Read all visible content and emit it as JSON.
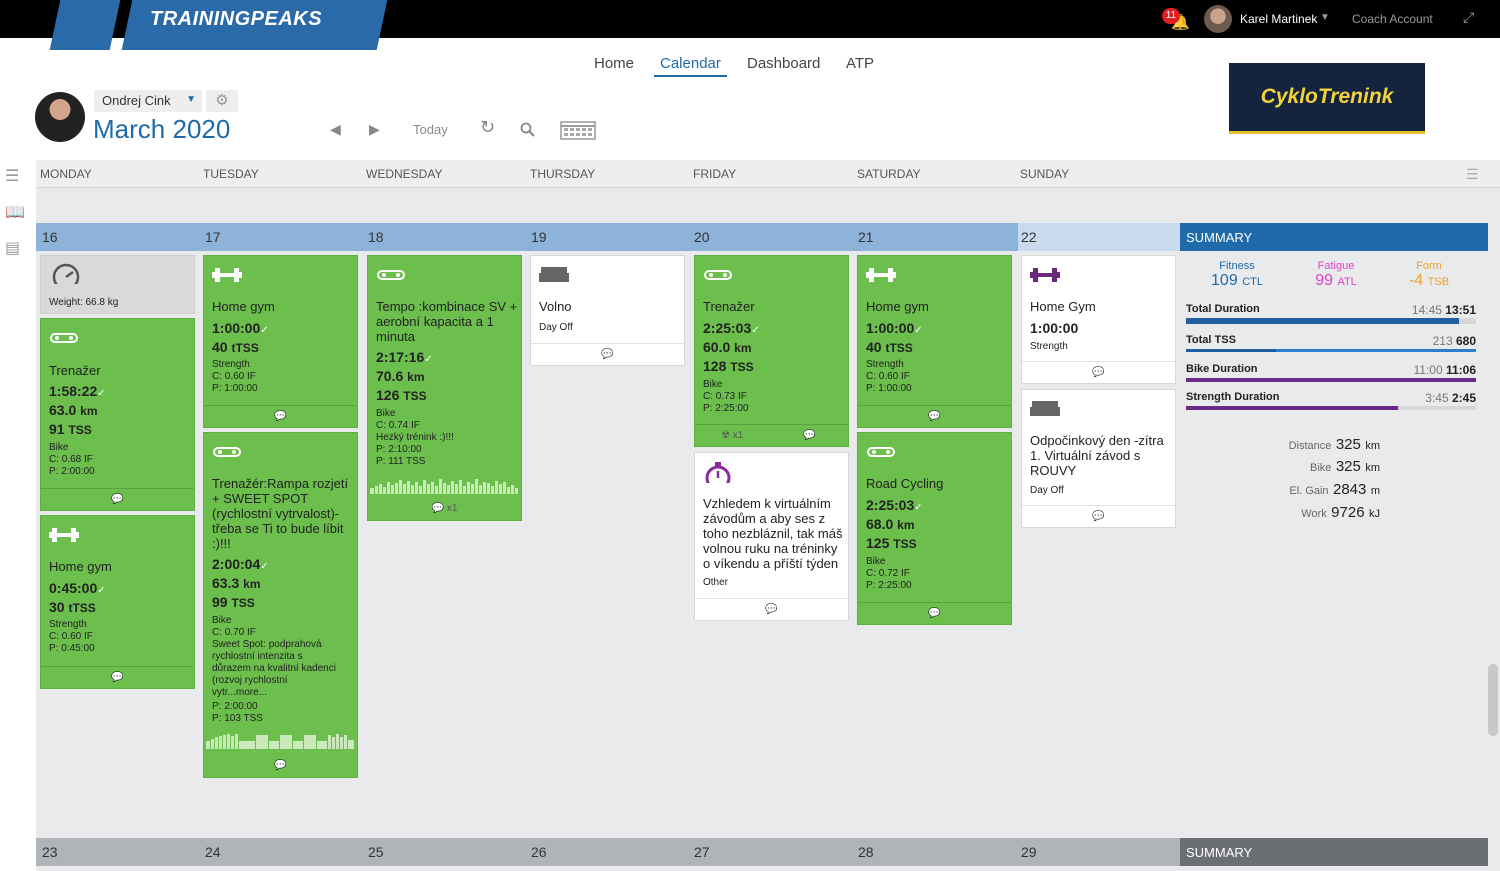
{
  "topbar": {
    "logo": "TRAININGPEAKS",
    "notifications": "11",
    "user_name": "Karel Martinek",
    "coach_account": "Coach Account"
  },
  "nav": {
    "home": "Home",
    "calendar": "Calendar",
    "dashboard": "Dashboard",
    "atp": "ATP"
  },
  "athlete": {
    "name": "Ondrej Cink",
    "month": "March",
    "year": "2020",
    "today": "Today"
  },
  "brand": "CykloTrenink",
  "days": [
    "MONDAY",
    "TUESDAY",
    "WEDNESDAY",
    "THURSDAY",
    "FRIDAY",
    "SATURDAY",
    "SUNDAY"
  ],
  "week1": [
    "16",
    "17",
    "18",
    "19",
    "20",
    "21",
    "22"
  ],
  "week2": [
    "23",
    "24",
    "25",
    "26",
    "27",
    "28",
    "29"
  ],
  "summary_label": "SUMMARY",
  "mon": {
    "weight": "Weight: 66.8 kg",
    "w1": {
      "title": "Trenažer",
      "dur": "1:58:22",
      "dist": "63.0",
      "dist_unit": "km",
      "tss": "91",
      "tss_unit": "TSS",
      "sport": "Bike",
      "c": "C: 0.68 IF",
      "p": "P: 2:00:00"
    },
    "w2": {
      "title": "Home gym",
      "dur": "0:45:00",
      "tss": "30",
      "tss_unit": "tTSS",
      "sport": "Strength",
      "c": "C: 0.60 IF",
      "p": "P: 0:45:00"
    }
  },
  "tue": {
    "w1": {
      "title": "Home gym",
      "dur": "1:00:00",
      "tss": "40",
      "tss_unit": "tTSS",
      "sport": "Strength",
      "c": "C: 0.60 IF",
      "p": "P: 1:00:00"
    },
    "w2": {
      "title_lines": [
        "Trenažér:Rampa rozjetí",
        "+ SWEET SPOT",
        "(rychlostní vytrvalost)-",
        "třeba se Ti to bude líbit",
        ":)!!!"
      ],
      "dur": "2:00:04",
      "dist": "63.3",
      "dist_unit": "km",
      "tss": "99",
      "tss_unit": "TSS",
      "sport": "Bike",
      "c": "C: 0.70 IF",
      "desc_lines": [
        "Sweet Spot: podprahová",
        "rychlostní intenzita s",
        "důrazem na kvalitní kadenci",
        "(rozvoj rychlostní",
        "vytr...more..."
      ],
      "p": "P: 2:00:00",
      "p2": "P: 103 TSS"
    }
  },
  "wed": {
    "w1": {
      "title_lines": [
        "Tempo :kombinace SV +",
        "aerobní kapacita a 1",
        "minuta"
      ],
      "dur": "2:17:16",
      "dist": "70.6",
      "dist_unit": "km",
      "tss": "126",
      "tss_unit": "TSS",
      "sport": "Bike",
      "c": "C: 0.74 IF",
      "note": "Hezký trénink :)!!!",
      "p": "P: 2:10:00",
      "p2": "P: 111 TSS",
      "comments": "x1"
    }
  },
  "thu": {
    "w1": {
      "title": "Volno",
      "sub": "Day Off"
    }
  },
  "fri": {
    "w1": {
      "title": "Trenažer",
      "dur": "2:25:03",
      "dist": "60.0",
      "dist_unit": "km",
      "tss": "128",
      "tss_unit": "TSS",
      "sport": "Bike",
      "c": "C: 0.73 IF",
      "p": "P: 2:25:00",
      "equip": "x1"
    },
    "w2": {
      "title_lines": [
        "Vzhledem k virtuálním",
        "závodům a aby ses z",
        "toho nezbláznil, tak máš",
        "volnou ruku na tréninky",
        "o víkendu a příští týden"
      ],
      "sub": "Other"
    }
  },
  "sat": {
    "w1": {
      "title": "Home gym",
      "dur": "1:00:00",
      "tss": "40",
      "tss_unit": "tTSS",
      "sport": "Strength",
      "c": "C: 0.60 IF",
      "p": "P: 1:00:00"
    },
    "w2": {
      "title": "Road Cycling",
      "dur": "2:25:03",
      "dist": "68.0",
      "dist_unit": "km",
      "tss": "125",
      "tss_unit": "TSS",
      "sport": "Bike",
      "c": "C: 0.72 IF",
      "p": "P: 2:25:00"
    }
  },
  "sun": {
    "w1": {
      "title": "Home Gym",
      "dur": "1:00:00",
      "sub": "Strength"
    },
    "w2": {
      "title_lines": [
        "Odpočinkový den -zítra",
        "1. Virtuální závod s",
        "ROUVY"
      ],
      "sub": "Day Off"
    }
  },
  "summary": {
    "fitness": {
      "label": "Fitness",
      "value": "109",
      "unit": "CTL",
      "color": "#1f6aa8"
    },
    "fatigue": {
      "label": "Fatigue",
      "value": "99",
      "unit": "ATL",
      "color": "#e040c8"
    },
    "form": {
      "label": "Form",
      "value": "-4",
      "unit": "TSB",
      "color": "#f0a030"
    },
    "rows": [
      {
        "label": "Total Duration",
        "planned": "14:45",
        "actual": "13:51",
        "fill": 0.94,
        "color": "#1f5fa0"
      },
      {
        "label": "Total TSS",
        "planned": "213",
        "actual": "680",
        "fill": 0.31,
        "color": "#2b7fd0",
        "fill2": 1.0,
        "color2": "#2b7fd0"
      },
      {
        "label": "Bike Duration",
        "planned": "11:00",
        "actual": "11:06",
        "fill": 1.0,
        "color": "#6a2a8a"
      },
      {
        "label": "Strength Duration",
        "planned": "3:45",
        "actual": "2:45",
        "fill": 0.73,
        "color": "#6a2a8a"
      }
    ],
    "stats": [
      {
        "label": "Distance",
        "value": "325",
        "unit": "km"
      },
      {
        "label": "Bike",
        "value": "325",
        "unit": "km"
      },
      {
        "label": "El. Gain",
        "value": "2843",
        "unit": "m"
      },
      {
        "label": "Work",
        "value": "9726",
        "unit": "kJ"
      }
    ]
  }
}
